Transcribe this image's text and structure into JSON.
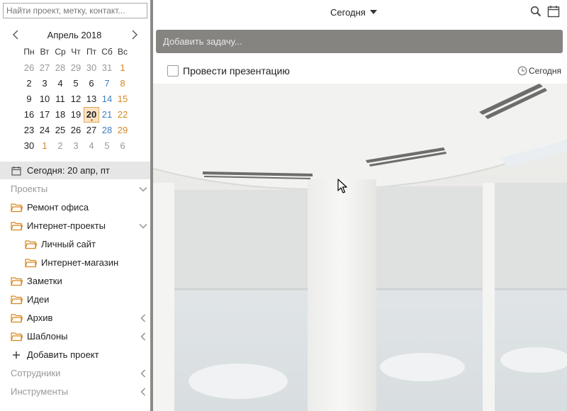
{
  "sidebar": {
    "search_placeholder": "Найти проект, метку, контакт...",
    "calendar": {
      "title": "Апрель 2018",
      "weekdays": [
        "Пн",
        "Вт",
        "Ср",
        "Чт",
        "Пт",
        "Сб",
        "Вс"
      ],
      "weeks": [
        [
          "26",
          "27",
          "28",
          "29",
          "30",
          "31",
          "1"
        ],
        [
          "2",
          "3",
          "4",
          "5",
          "6",
          "7",
          "8"
        ],
        [
          "9",
          "10",
          "11",
          "12",
          "13",
          "14",
          "15"
        ],
        [
          "16",
          "17",
          "18",
          "19",
          "20",
          "21",
          "22"
        ],
        [
          "23",
          "24",
          "25",
          "26",
          "27",
          "28",
          "29"
        ],
        [
          "30",
          "1",
          "2",
          "3",
          "4",
          "5",
          "6"
        ]
      ],
      "selected_day": "20"
    },
    "today_label": "Сегодня: 20 апр, пт",
    "sections": {
      "projects": "Проекты",
      "staff": "Сотрудники",
      "tools": "Инструменты"
    },
    "projects": [
      {
        "label": "Ремонт офиса"
      },
      {
        "label": "Интернет-проекты"
      },
      {
        "label": "Личный сайт"
      },
      {
        "label": "Интернет-магазин"
      },
      {
        "label": "Заметки"
      },
      {
        "label": "Идеи"
      },
      {
        "label": "Архив"
      },
      {
        "label": "Шаблоны"
      }
    ],
    "add_project": "Добавить проект"
  },
  "topbar": {
    "date_label": "Сегодня"
  },
  "add_task_placeholder": "Добавить задачу...",
  "tasks": [
    {
      "title": "Провести презентацию",
      "due": "Сегодня"
    }
  ],
  "colors": {
    "accent_orange": "#d7861f",
    "saturday_blue": "#3f7fbf",
    "add_task_bar": "#858481",
    "divider": "#8a8a87"
  },
  "icons": [
    "search-icon",
    "calendar-icon",
    "folder-icon",
    "chevron-down-icon",
    "chevron-left-icon",
    "plus-icon",
    "clock-icon"
  ]
}
